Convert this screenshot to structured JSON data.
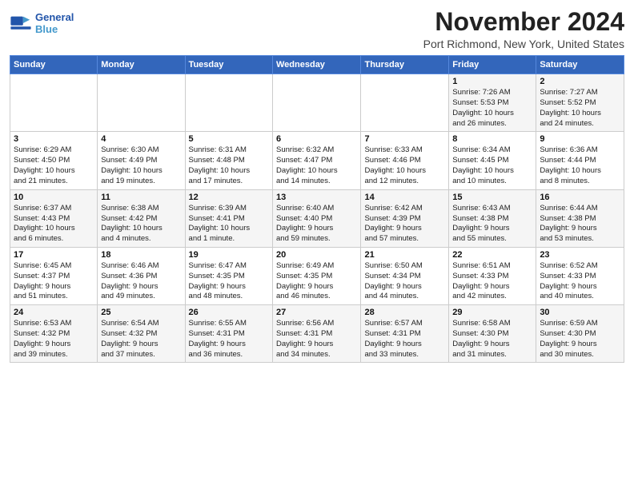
{
  "header": {
    "month_title": "November 2024",
    "location": "Port Richmond, New York, United States"
  },
  "logo": {
    "line1": "General",
    "line2": "Blue"
  },
  "days_of_week": [
    "Sunday",
    "Monday",
    "Tuesday",
    "Wednesday",
    "Thursday",
    "Friday",
    "Saturday"
  ],
  "weeks": [
    [
      {
        "day": "",
        "info": ""
      },
      {
        "day": "",
        "info": ""
      },
      {
        "day": "",
        "info": ""
      },
      {
        "day": "",
        "info": ""
      },
      {
        "day": "",
        "info": ""
      },
      {
        "day": "1",
        "info": "Sunrise: 7:26 AM\nSunset: 5:53 PM\nDaylight: 10 hours\nand 26 minutes."
      },
      {
        "day": "2",
        "info": "Sunrise: 7:27 AM\nSunset: 5:52 PM\nDaylight: 10 hours\nand 24 minutes."
      }
    ],
    [
      {
        "day": "3",
        "info": "Sunrise: 6:29 AM\nSunset: 4:50 PM\nDaylight: 10 hours\nand 21 minutes."
      },
      {
        "day": "4",
        "info": "Sunrise: 6:30 AM\nSunset: 4:49 PM\nDaylight: 10 hours\nand 19 minutes."
      },
      {
        "day": "5",
        "info": "Sunrise: 6:31 AM\nSunset: 4:48 PM\nDaylight: 10 hours\nand 17 minutes."
      },
      {
        "day": "6",
        "info": "Sunrise: 6:32 AM\nSunset: 4:47 PM\nDaylight: 10 hours\nand 14 minutes."
      },
      {
        "day": "7",
        "info": "Sunrise: 6:33 AM\nSunset: 4:46 PM\nDaylight: 10 hours\nand 12 minutes."
      },
      {
        "day": "8",
        "info": "Sunrise: 6:34 AM\nSunset: 4:45 PM\nDaylight: 10 hours\nand 10 minutes."
      },
      {
        "day": "9",
        "info": "Sunrise: 6:36 AM\nSunset: 4:44 PM\nDaylight: 10 hours\nand 8 minutes."
      }
    ],
    [
      {
        "day": "10",
        "info": "Sunrise: 6:37 AM\nSunset: 4:43 PM\nDaylight: 10 hours\nand 6 minutes."
      },
      {
        "day": "11",
        "info": "Sunrise: 6:38 AM\nSunset: 4:42 PM\nDaylight: 10 hours\nand 4 minutes."
      },
      {
        "day": "12",
        "info": "Sunrise: 6:39 AM\nSunset: 4:41 PM\nDaylight: 10 hours\nand 1 minute."
      },
      {
        "day": "13",
        "info": "Sunrise: 6:40 AM\nSunset: 4:40 PM\nDaylight: 9 hours\nand 59 minutes."
      },
      {
        "day": "14",
        "info": "Sunrise: 6:42 AM\nSunset: 4:39 PM\nDaylight: 9 hours\nand 57 minutes."
      },
      {
        "day": "15",
        "info": "Sunrise: 6:43 AM\nSunset: 4:38 PM\nDaylight: 9 hours\nand 55 minutes."
      },
      {
        "day": "16",
        "info": "Sunrise: 6:44 AM\nSunset: 4:38 PM\nDaylight: 9 hours\nand 53 minutes."
      }
    ],
    [
      {
        "day": "17",
        "info": "Sunrise: 6:45 AM\nSunset: 4:37 PM\nDaylight: 9 hours\nand 51 minutes."
      },
      {
        "day": "18",
        "info": "Sunrise: 6:46 AM\nSunset: 4:36 PM\nDaylight: 9 hours\nand 49 minutes."
      },
      {
        "day": "19",
        "info": "Sunrise: 6:47 AM\nSunset: 4:35 PM\nDaylight: 9 hours\nand 48 minutes."
      },
      {
        "day": "20",
        "info": "Sunrise: 6:49 AM\nSunset: 4:35 PM\nDaylight: 9 hours\nand 46 minutes."
      },
      {
        "day": "21",
        "info": "Sunrise: 6:50 AM\nSunset: 4:34 PM\nDaylight: 9 hours\nand 44 minutes."
      },
      {
        "day": "22",
        "info": "Sunrise: 6:51 AM\nSunset: 4:33 PM\nDaylight: 9 hours\nand 42 minutes."
      },
      {
        "day": "23",
        "info": "Sunrise: 6:52 AM\nSunset: 4:33 PM\nDaylight: 9 hours\nand 40 minutes."
      }
    ],
    [
      {
        "day": "24",
        "info": "Sunrise: 6:53 AM\nSunset: 4:32 PM\nDaylight: 9 hours\nand 39 minutes."
      },
      {
        "day": "25",
        "info": "Sunrise: 6:54 AM\nSunset: 4:32 PM\nDaylight: 9 hours\nand 37 minutes."
      },
      {
        "day": "26",
        "info": "Sunrise: 6:55 AM\nSunset: 4:31 PM\nDaylight: 9 hours\nand 36 minutes."
      },
      {
        "day": "27",
        "info": "Sunrise: 6:56 AM\nSunset: 4:31 PM\nDaylight: 9 hours\nand 34 minutes."
      },
      {
        "day": "28",
        "info": "Sunrise: 6:57 AM\nSunset: 4:31 PM\nDaylight: 9 hours\nand 33 minutes."
      },
      {
        "day": "29",
        "info": "Sunrise: 6:58 AM\nSunset: 4:30 PM\nDaylight: 9 hours\nand 31 minutes."
      },
      {
        "day": "30",
        "info": "Sunrise: 6:59 AM\nSunset: 4:30 PM\nDaylight: 9 hours\nand 30 minutes."
      }
    ]
  ]
}
